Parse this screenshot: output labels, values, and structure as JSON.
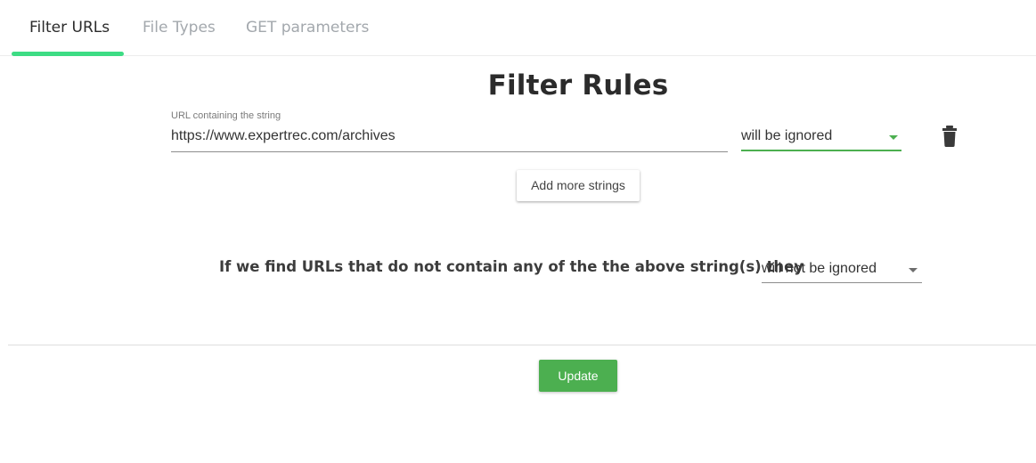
{
  "tabs": [
    {
      "label": "Filter URLs",
      "active": true
    },
    {
      "label": "File Types",
      "active": false
    },
    {
      "label": "GET parameters",
      "active": false
    }
  ],
  "title": "Filter Rules",
  "rule": {
    "field_label": "URL containing the string",
    "url_value": "https://www.expertrec.com/archives",
    "action_value": "will be ignored",
    "delete_icon": "trash-icon"
  },
  "add_button_label": "Add more strings",
  "fallback": {
    "question": "If we find URLs that do not contain any of the the above string(s) they",
    "action_value": "will not be ignored"
  },
  "update_button_label": "Update",
  "colors": {
    "accent_tab": "#3ddc84",
    "primary_green": "#4caf50"
  }
}
